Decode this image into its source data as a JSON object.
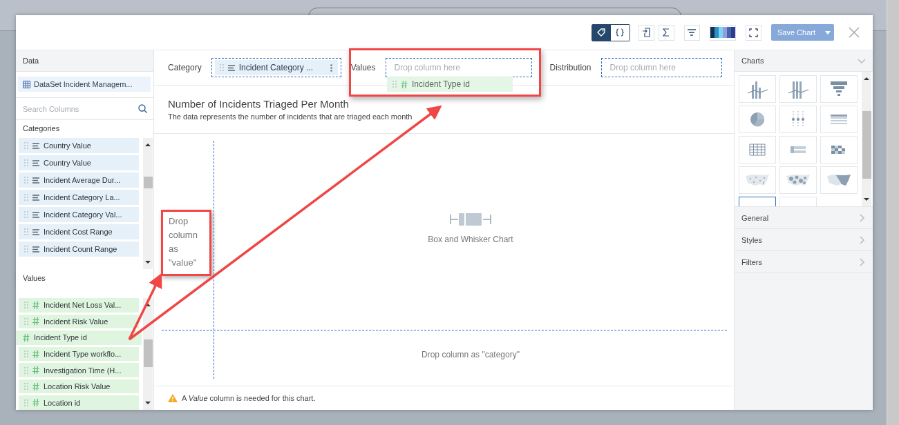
{
  "toolbar": {
    "view_toggle": [
      {
        "selected": true
      },
      {
        "selected": false
      }
    ],
    "save_button": {
      "label": "Save Chart",
      "disabled": true
    }
  },
  "data_panel": {
    "title": "Data",
    "dataset": "DataSet Incident Managem...",
    "search_placeholder": "Search Columns",
    "categories": {
      "title": "Categories",
      "items": [
        {
          "label": "Country Value"
        },
        {
          "label": "Country Value"
        },
        {
          "label": "Incident Average Dur..."
        },
        {
          "label": "Incident Category La..."
        },
        {
          "label": "Incident Category Val..."
        },
        {
          "label": "Incident Cost Range"
        },
        {
          "label": "Incident Count Range"
        }
      ]
    },
    "values": {
      "title": "Values",
      "items": [
        {
          "label": "Incident Net Loss Val...",
          "dragging": false
        },
        {
          "label": "Incident Risk Value",
          "dragging": false
        },
        {
          "label": "Incident Type id",
          "dragging": true
        },
        {
          "label": "Incident Type workflo...",
          "dragging": false
        },
        {
          "label": "Investigation Time (H...",
          "dragging": false
        },
        {
          "label": "Location Risk Value",
          "dragging": false
        },
        {
          "label": "Location id",
          "dragging": false
        }
      ]
    }
  },
  "fields": [
    {
      "label": "Category",
      "chip": "Incident Category ..."
    },
    {
      "label": "Values",
      "placeholder": "Drop column here"
    },
    {
      "label": "Distribution",
      "placeholder": "Drop column here"
    }
  ],
  "drag_chip": "Incident Type id",
  "chart": {
    "title": "Number of Incidents Triaged Per Month",
    "subtitle": "The data represents the number of incidents that are triaged each month",
    "value_hint": "Drop column as \"value\"",
    "empty_label": "Box and Whisker Chart",
    "category_hint": "Drop column as \"category\""
  },
  "warning": "A *Value* column is needed for this chart.",
  "charts_panel": {
    "title": "Charts",
    "tiles": [
      {
        "kind": "combo",
        "selected": false
      },
      {
        "kind": "combo-stacked",
        "selected": false
      },
      {
        "kind": "funnel",
        "selected": false
      },
      {
        "kind": "pie",
        "selected": false
      },
      {
        "kind": "dots",
        "selected": false
      },
      {
        "kind": "table",
        "selected": false
      },
      {
        "kind": "grid",
        "selected": false
      },
      {
        "kind": "pivot",
        "selected": false
      },
      {
        "kind": "heatmap",
        "selected": false
      },
      {
        "kind": "map-dots",
        "selected": false
      },
      {
        "kind": "map-bubbles",
        "selected": false
      },
      {
        "kind": "map-fill",
        "selected": false
      },
      {
        "kind": "blank",
        "selected": true
      },
      {
        "kind": "blank",
        "selected": false
      }
    ],
    "sections": [
      "General",
      "Styles",
      "Filters"
    ]
  }
}
